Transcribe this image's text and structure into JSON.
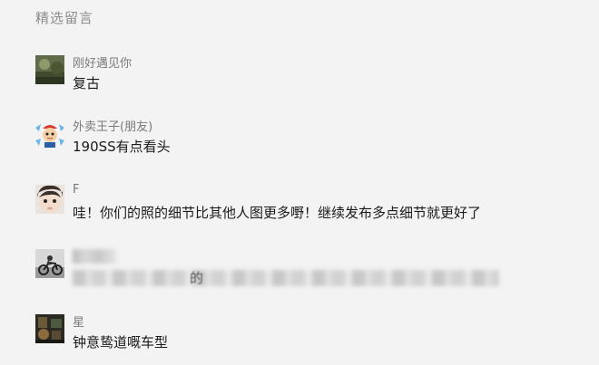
{
  "section": {
    "title": "精选留言"
  },
  "comments": [
    {
      "nickname": "刚好遇见你",
      "text": "复古"
    },
    {
      "nickname": "外卖王子(朋友)",
      "text": "190SS有点看头"
    },
    {
      "nickname": "F",
      "text": "哇！你们的照的细节比其他人图更多嘢！继续发布多点细节就更好了"
    },
    {
      "nickname": "",
      "text": "的",
      "redacted": true
    },
    {
      "nickname": "星",
      "text": "钟意鸷道嘅车型"
    }
  ]
}
